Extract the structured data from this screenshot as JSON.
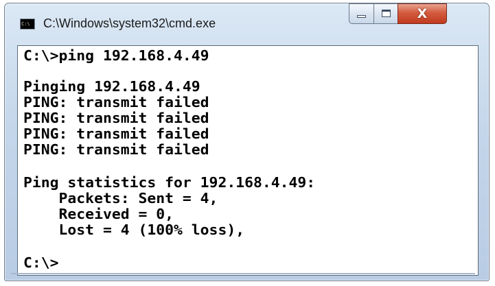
{
  "window": {
    "title": "C:\\Windows\\system32\\cmd.exe",
    "app_icon_text": "C:\\",
    "close_glyph": "X"
  },
  "console": {
    "lines": [
      "C:\\>ping 192.168.4.49",
      "Pinging 192.168.4.49",
      "PING: transmit failed",
      "PING: transmit failed",
      "PING: transmit failed",
      "PING: transmit failed",
      "Ping statistics for 192.168.4.49:",
      "    Packets: Sent = 4,",
      "    Received = 0,",
      "    Lost = 4 (100% loss),",
      "C:\\>"
    ]
  },
  "colors": {
    "title_bar": "#c4d6ea",
    "close_button": "#c8452a",
    "console_bg": "#ffffff",
    "console_text": "#000000"
  }
}
